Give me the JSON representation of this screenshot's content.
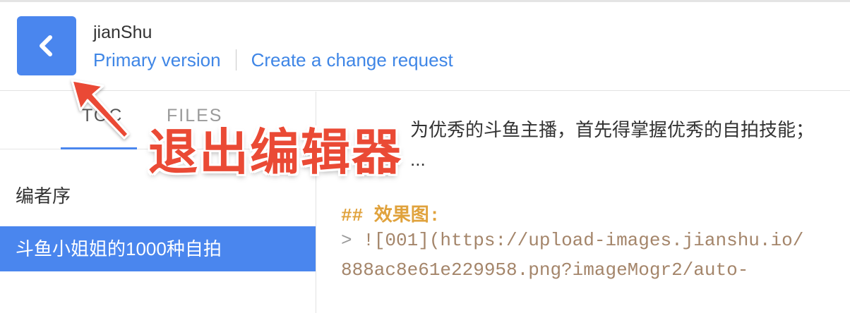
{
  "header": {
    "book_title": "jianShu",
    "primary_version_label": "Primary version",
    "change_request_label": "Create a change request",
    "back_icon": "chevron-left-icon"
  },
  "sidebar": {
    "tabs": [
      {
        "label": "TOC",
        "active": true
      },
      {
        "label": "FILES",
        "active": false
      }
    ],
    "items": [
      {
        "label": "编者序",
        "selected": false
      },
      {
        "label": "斗鱼小姐姐的1000种自拍",
        "selected": true
      }
    ]
  },
  "editor": {
    "line1": "为优秀的斗鱼主播，首先得掌握优秀的自拍技能；",
    "line2": "...",
    "heading": "## 效果图:",
    "code1_prefix": "> ",
    "code1": "![001](https://upload-images.jianshu.io/",
    "code2": "888ac8e61e229958.png?imageMogr2/auto-"
  },
  "annotation": {
    "text": "退出编辑器"
  },
  "colors": {
    "accent": "#4a86ee",
    "link": "#3f86e6",
    "annotation": "#ea4a35",
    "heading": "#e0a23c",
    "code": "#a4856a"
  }
}
